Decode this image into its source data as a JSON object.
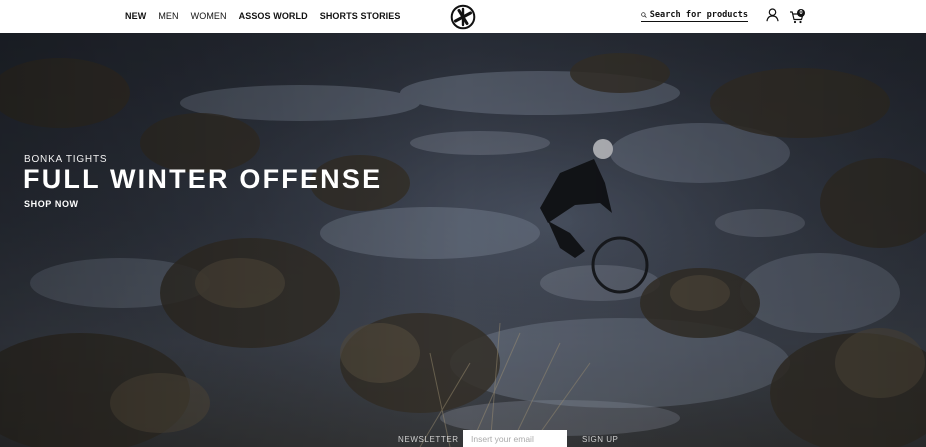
{
  "nav": {
    "items": [
      {
        "label": "NEW"
      },
      {
        "label": "MEN"
      },
      {
        "label": "WOMEN"
      },
      {
        "label": "ASSOS WORLD"
      },
      {
        "label": "SHORTS STORIES"
      }
    ]
  },
  "search": {
    "placeholder": "Search for products"
  },
  "cart": {
    "count": "0"
  },
  "hero": {
    "eyebrow": "BONKA TIGHTS",
    "headline": "FULL WINTER OFFENSE",
    "cta": "SHOP NOW"
  },
  "newsletter": {
    "label": "NEWSLETTER",
    "placeholder": "Insert your email",
    "button": "SIGN UP"
  }
}
